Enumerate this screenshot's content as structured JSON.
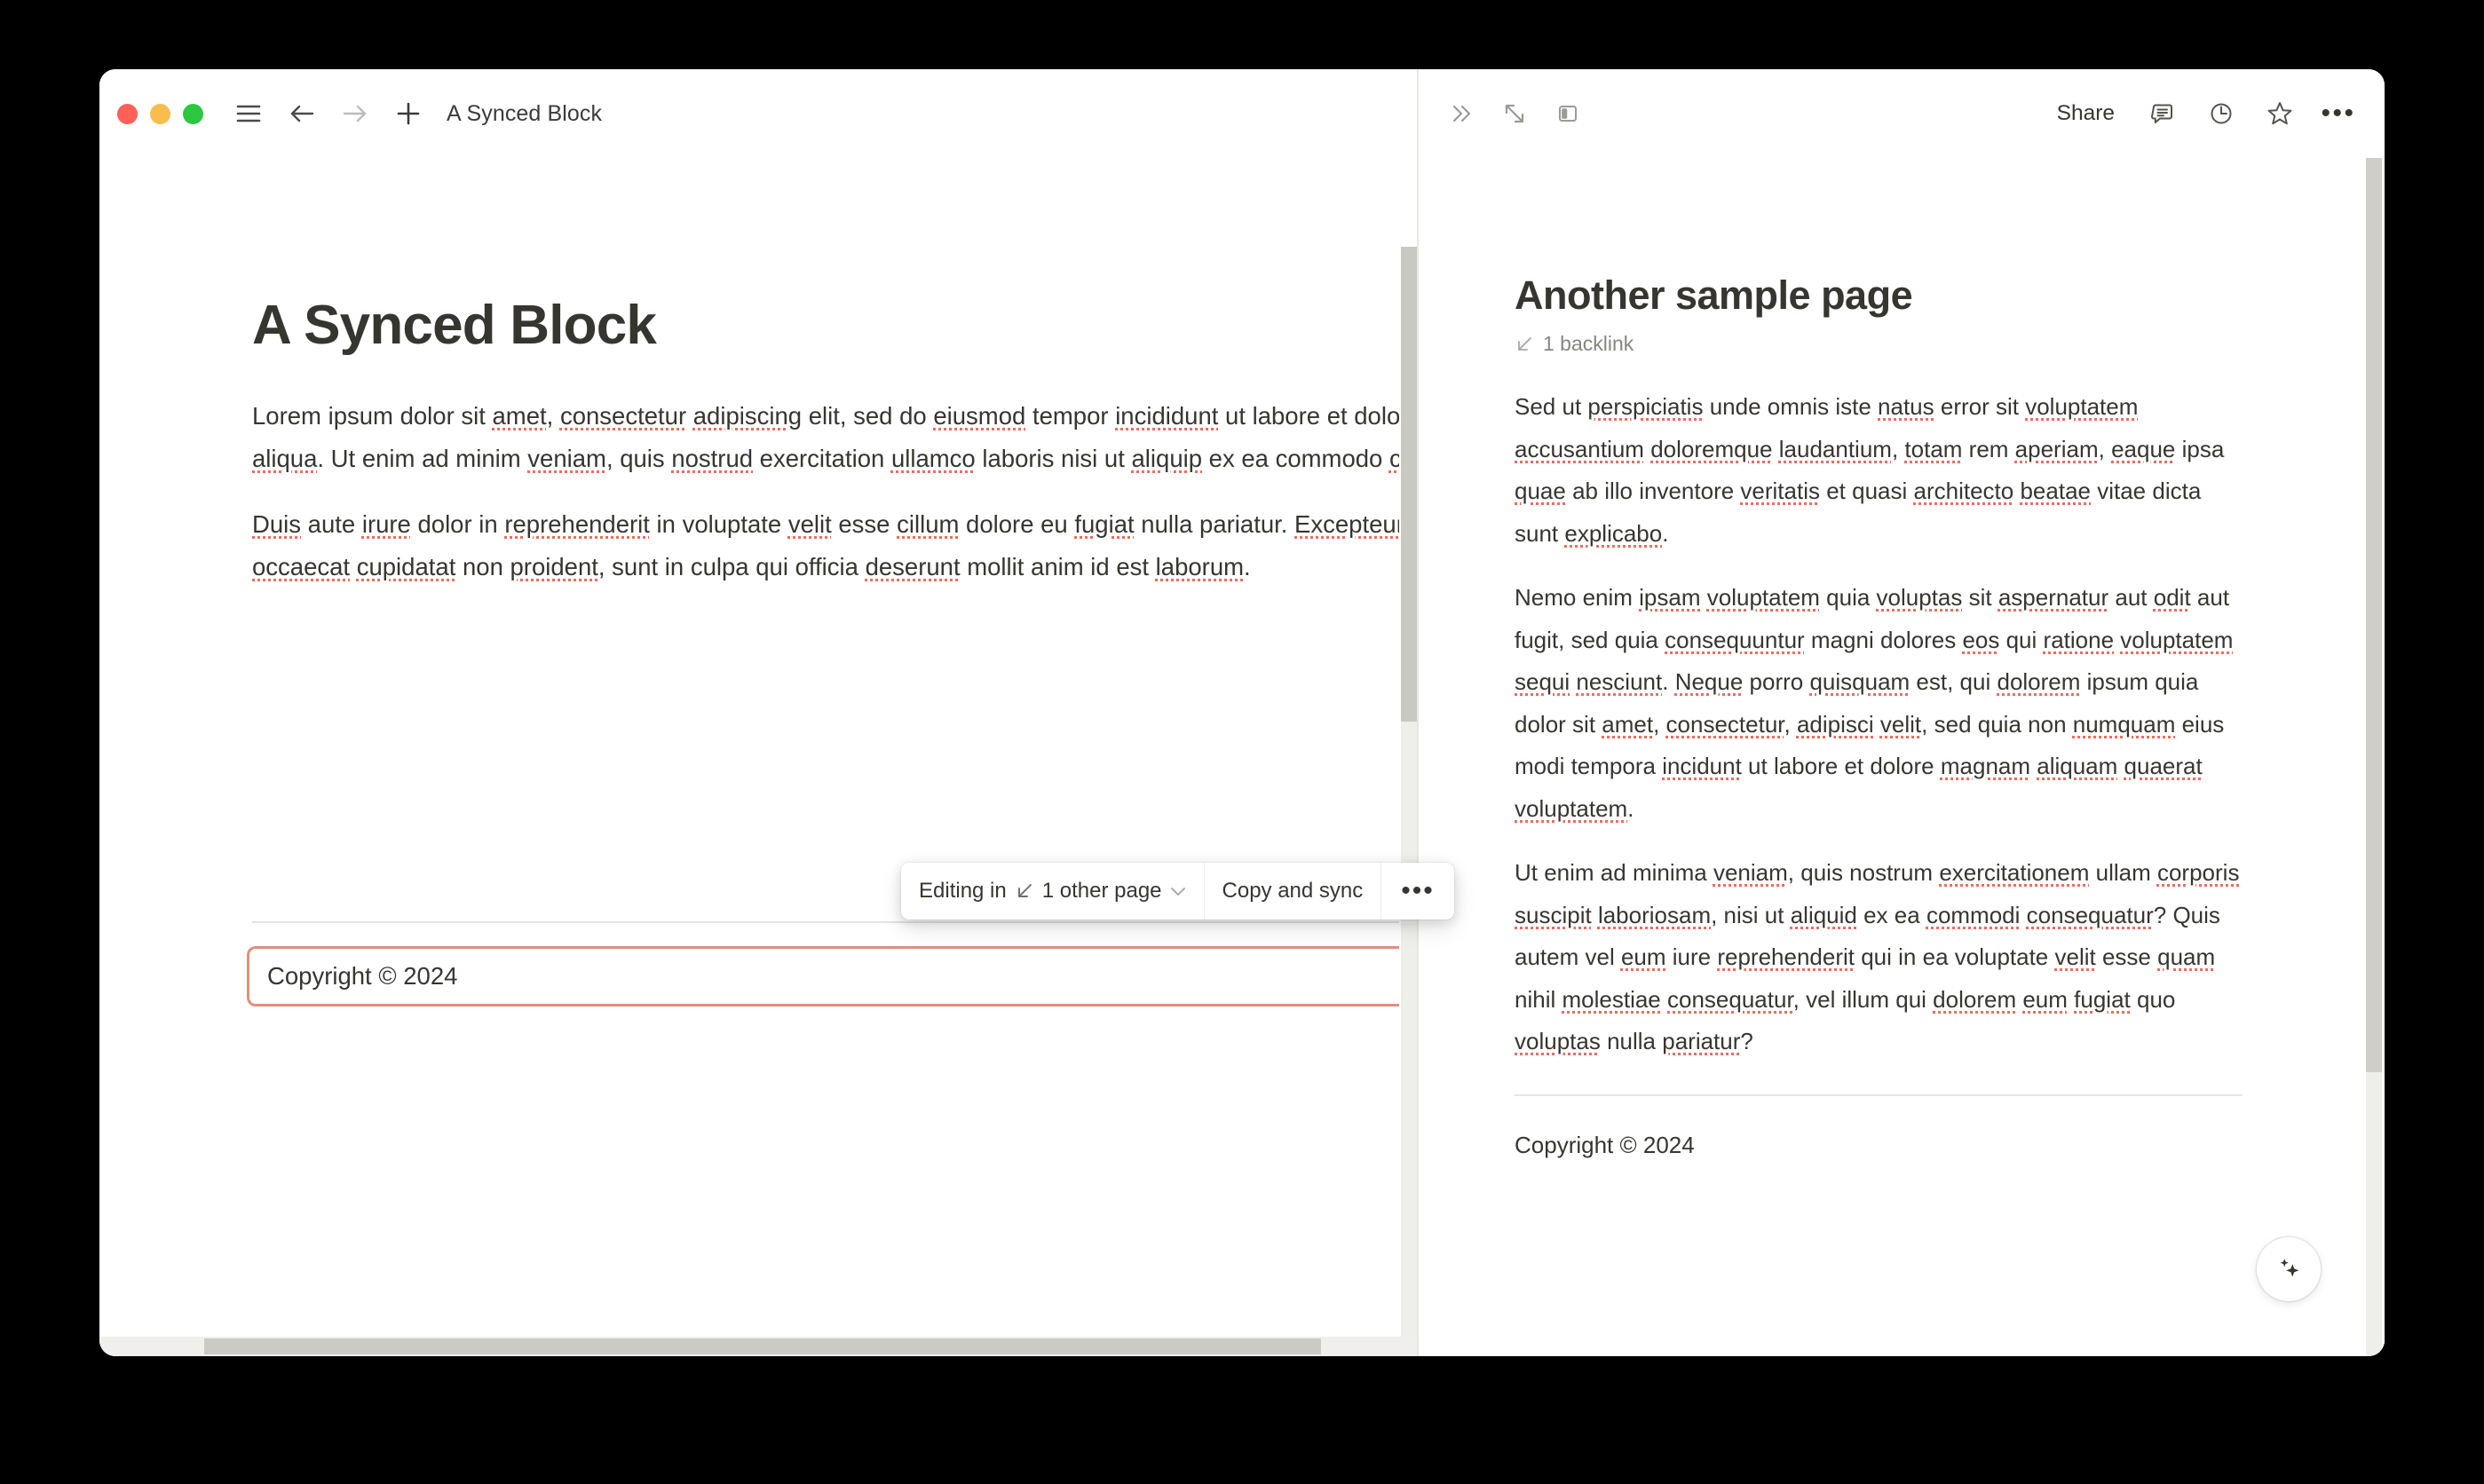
{
  "window": {
    "traffic_lights": {
      "close_color": "#ff6058",
      "minimize_color": "#f9bd4e",
      "maximize_color": "#2bc840"
    },
    "title": "A Synced Block"
  },
  "left_panel": {
    "titlebar": {
      "menu_icon": "hamburger-menu-icon",
      "back_icon": "arrow-left-icon",
      "forward_icon": "arrow-right-icon",
      "new_icon": "plus-icon",
      "title": "A Synced Block"
    },
    "doc": {
      "title": "A Synced Block",
      "paragraph_1": "Lorem ipsum dolor sit amet, consectetur adipiscing elit, sed do eiusmod tempor incididunt ut labore et dolore magna aliqua. Ut enim ad minim veniam, quis nostrud exercitation ullamco laboris nisi ut aliquip ex ea commodo consequat.",
      "paragraph_2": "Duis aute irure dolor in reprehenderit in voluptate velit esse cillum dolore eu fugiat nulla pariatur. Excepteur sint occaecat cupidatat non proident, sunt in culpa qui officia deserunt mollit anim id est laborum.",
      "synced_block_text": "Copyright © 2024",
      "synced_block_border_color": "#e08f7e"
    },
    "sync_toolbar": {
      "editing_in_label": "Editing in",
      "pages_label": "1 other page",
      "copy_and_sync_label": "Copy and sync",
      "more_label": "•••",
      "arrow_icon": "arrow-down-left-icon",
      "chevron_icon": "chevron-down-icon"
    },
    "scrollbar": {
      "thumb_color": "#c9c8c2",
      "track_color": "#eeeeea"
    }
  },
  "right_panel": {
    "topbar": {
      "collapse_icon": "chevron-double-right-icon",
      "expand_icon": "expand-diagonal-icon",
      "sidepanel_icon": "side-peek-icon",
      "share_label": "Share",
      "comment_icon": "comment-icon",
      "history_icon": "clock-history-icon",
      "favorite_icon": "star-icon",
      "more_icon": "ellipsis-icon",
      "more_label": "•••"
    },
    "doc": {
      "title": "Another sample page",
      "backlink_icon": "arrow-down-left-icon",
      "backlink_label": "1 backlink",
      "paragraph_1": "Sed ut perspiciatis unde omnis iste natus error sit voluptatem accusantium doloremque laudantium, totam rem aperiam, eaque ipsa quae ab illo inventore veritatis et quasi architecto beatae vitae dicta sunt explicabo.",
      "paragraph_2": "Nemo enim ipsam voluptatem quia voluptas sit aspernatur aut odit aut fugit, sed quia consequuntur magni dolores eos qui ratione voluptatem sequi nesciunt. Neque porro quisquam est, qui dolorem ipsum quia dolor sit amet, consectetur, adipisci velit, sed quia non numquam eius modi tempora incidunt ut labore et dolore magnam aliquam quaerat voluptatem.",
      "paragraph_3": "Ut enim ad minima veniam, quis nostrum exercitationem ullam corporis suscipit laboriosam, nisi ut aliquid ex ea commodi consequatur? Quis autem vel eum iure reprehenderit qui in ea voluptate velit esse quam nihil molestiae consequatur, vel illum qui dolorem eum fugiat quo voluptas nulla pariatur?",
      "copyright": "Copyright © 2024"
    },
    "ai_button_icon": "sparkle-icon",
    "scrollbar": {
      "thumb_color": "#cfcec8",
      "track_color": "#eeeeea"
    }
  }
}
